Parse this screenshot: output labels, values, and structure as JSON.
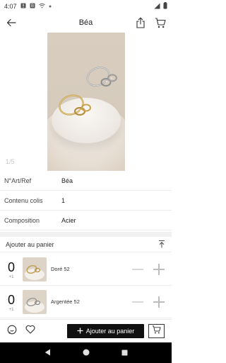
{
  "status_bar": {
    "time": "4:07"
  },
  "app_bar": {
    "title": "Béa"
  },
  "gallery": {
    "pager": "1/5"
  },
  "details": [
    {
      "key": "N°Art/Ref",
      "value": "Béa"
    },
    {
      "key": "Contenu colis",
      "value": "1"
    },
    {
      "key": "Composition",
      "value": "Acier"
    }
  ],
  "cart_section": {
    "title": "Ajouter au panier"
  },
  "variants": [
    {
      "qty": "0",
      "unit": "+1",
      "label": "Doré 52"
    },
    {
      "qty": "0",
      "unit": "+1",
      "label": "Argentée 52"
    }
  ],
  "bottom_bar": {
    "add_to_cart_label": "Ajouter au panier"
  },
  "colors": {
    "accent": "#111111",
    "divider": "#ededed"
  }
}
